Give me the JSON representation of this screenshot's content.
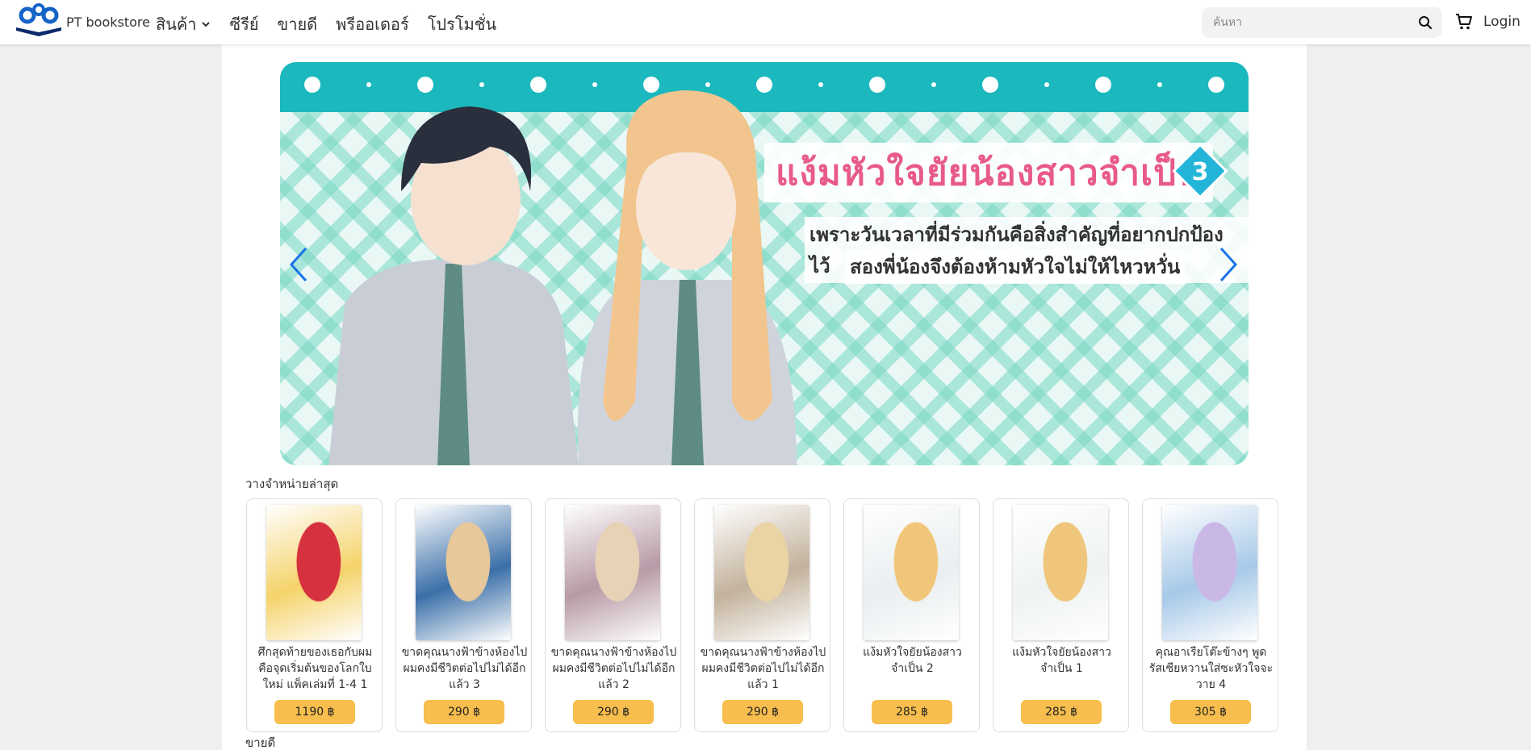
{
  "header": {
    "brand": "PT bookstore",
    "nav": [
      {
        "label": "สินค้า",
        "has_dropdown": true
      },
      {
        "label": "ซีรีย์"
      },
      {
        "label": "ขายดี"
      },
      {
        "label": "พรีออเดอร์"
      },
      {
        "label": "โปรโมชั่น"
      }
    ],
    "search_placeholder": "ค้นหา",
    "login_label": "Login",
    "icons": [
      "logo-icon",
      "chevron-down-icon",
      "search-icon",
      "cart-icon"
    ]
  },
  "banner": {
    "title": "แง้มหัวใจยัยน้องสาวจำเป็น",
    "volume": "3",
    "line1": "เพราะวันเวลาที่มีร่วมกันคือสิ่งสำคัญที่อยากปกป้องไว้",
    "line2": "สองพี่น้องจึงต้องห้ามหัวใจไม่ให้ไหวหวั่น",
    "colors": {
      "top_band": "#1bb8bd",
      "pattern": "#78d7c3",
      "title": "#e85a8b",
      "arrow": "#1a73e8"
    }
  },
  "sections": {
    "latest": "วางจำหน่ายล่าสุด",
    "bestseller": "ขายดี"
  },
  "products": [
    {
      "title": "ศึกสุดท้ายของเธอกับผมคือจุดเริ่มต้นของโลกใบใหม่ แพ็คเล่มที่ 1-4 1",
      "price": "1190 ฿",
      "cover_color": "#f5d36a",
      "cover_accent": "#d6313f"
    },
    {
      "title": "ขาดคุณนางฟ้าข้างห้องไป ผมคงมีชีวิตต่อไปไม่ได้อีกแล้ว 3",
      "price": "290 ฿",
      "cover_color": "#3a6fa8",
      "cover_accent": "#e7c89a"
    },
    {
      "title": "ขาดคุณนางฟ้าข้างห้องไป ผมคงมีชีวิตต่อไปไม่ได้อีกแล้ว 2",
      "price": "290 ฿",
      "cover_color": "#b79aa6",
      "cover_accent": "#e8d2b6"
    },
    {
      "title": "ขาดคุณนางฟ้าข้างห้องไป ผมคงมีชีวิตต่อไปไม่ได้อีกแล้ว 1",
      "price": "290 ฿",
      "cover_color": "#c3b29c",
      "cover_accent": "#ead3a4"
    },
    {
      "title": "แง้มหัวใจยัยน้องสาวจำเป็น 2",
      "price": "285 ฿",
      "cover_color": "#e9eef0",
      "cover_accent": "#f2c67a"
    },
    {
      "title": "แง้มหัวใจยัยน้องสาวจำเป็น 1",
      "price": "285 ฿",
      "cover_color": "#eef3f1",
      "cover_accent": "#f0c57c"
    },
    {
      "title": "คุณอาเรียโต๊ะข้างๆ พูดรัสเซียหวานใส่ซะหัวใจจะวาย 4",
      "price": "305 ฿",
      "cover_color": "#a7c9e8",
      "cover_accent": "#c9b8e6"
    }
  ]
}
